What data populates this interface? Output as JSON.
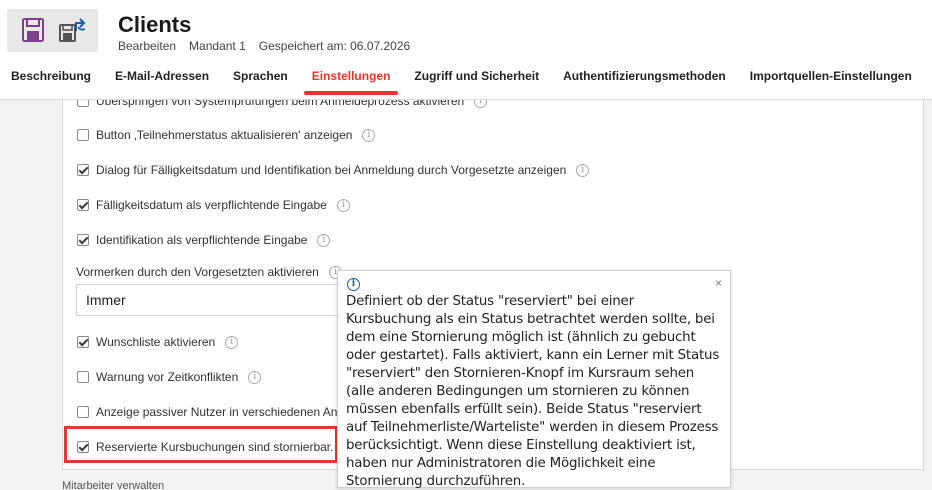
{
  "header": {
    "title": "Clients",
    "meta": [
      "Bearbeiten",
      "Mandant 1",
      "Gespeichert am: 06.07.2026"
    ]
  },
  "tabs": [
    {
      "label": "Beschreibung",
      "active": false
    },
    {
      "label": "E-Mail-Adressen",
      "active": false
    },
    {
      "label": "Sprachen",
      "active": false
    },
    {
      "label": "Einstellungen",
      "active": true
    },
    {
      "label": "Zugriff und Sicherheit",
      "active": false
    },
    {
      "label": "Authentifizierungsmethoden",
      "active": false
    },
    {
      "label": "Importquellen-Einstellungen",
      "active": false
    }
  ],
  "settings": {
    "row0": {
      "label": "Überspringen von Systemprüfungen beim Anmeldeprozess aktivieren",
      "checked": false
    },
    "row1": {
      "label": "Button ‚Teilnehmerstatus aktualisieren' anzeigen",
      "checked": false
    },
    "row2": {
      "label": "Dialog für Fälligkeitsdatum und Identifikation bei Anmeldung durch Vorgesetzte anzeigen",
      "checked": true
    },
    "row3": {
      "label": "Fälligkeitsdatum als verpflichtende Eingabe",
      "checked": true
    },
    "row4": {
      "label": "Identifikation als verpflichtende Eingabe",
      "checked": true
    },
    "select_label": "Vormerken durch den Vorgesetzten aktivieren",
    "select_value": "Immer",
    "row5": {
      "label": "Wunschliste aktivieren",
      "checked": true
    },
    "row6": {
      "label": "Warnung vor Zeitkonflikten",
      "checked": false
    },
    "row7": {
      "label": "Anzeige passiver Nutzer in verschiedenen An",
      "checked": false
    },
    "row8": {
      "label": "Reservierte Kursbuchungen sind stornierbar.",
      "checked": true
    }
  },
  "below_text": "Mitarbeiter verwalten",
  "tooltip": {
    "close": "×",
    "text": "Definiert ob der Status \"reserviert\" bei einer Kursbuchung als ein Status betrachtet werden sollte, bei dem eine Stornierung möglich ist (ähnlich zu gebucht oder gestartet). Falls aktiviert, kann ein Lerner mit Status \"reserviert\" den Stornieren-Knopf im Kursraum sehen (alle anderen Bedingungen um stornieren zu können müssen ebenfalls erfüllt sein). Beide Status \"reserviert auf Teilnehmerliste/Warteliste\" werden in diesem Prozess berücksichtigt. Wenn diese Einstellung deaktiviert ist, haben nur Administratoren die Möglichkeit eine Stornierung durchzuführen."
  },
  "colors": {
    "accent": "#e0382f",
    "save_icon": "#7b3f8c",
    "info_icon": "#1e5aa8"
  },
  "icons": [
    "save-icon",
    "publish-icon",
    "info-icon",
    "close-icon"
  ]
}
